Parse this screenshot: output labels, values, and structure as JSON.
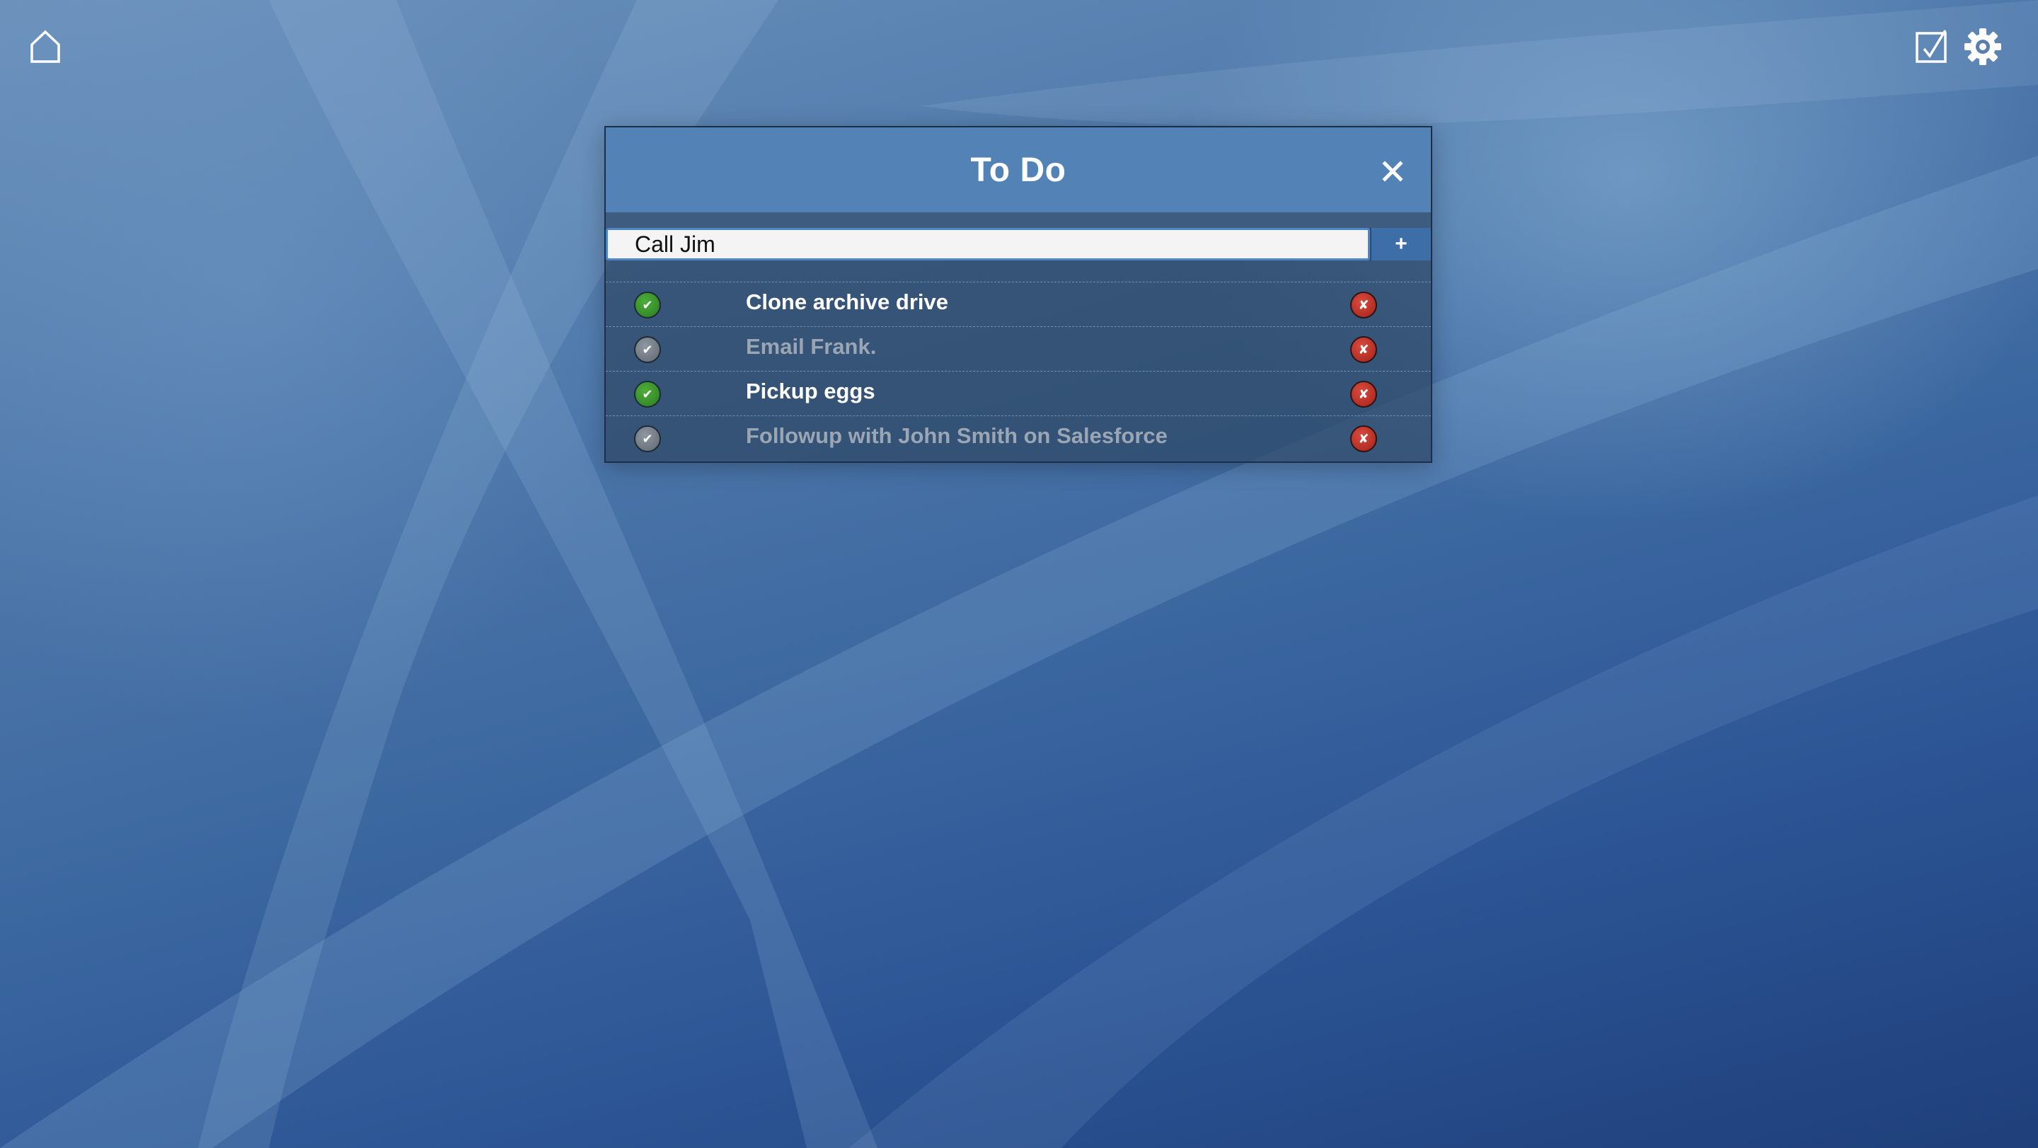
{
  "desktop": {
    "home_icon": "home-icon",
    "tasks_icon": "checkbox-icon",
    "settings_icon": "gear-icon"
  },
  "todo": {
    "title": "To Do",
    "close_icon": "close-icon",
    "input_value": "Call Jim",
    "add_label": "+",
    "check_glyph": "✔",
    "delete_glyph": "✘",
    "items": [
      {
        "text": "Clone archive drive",
        "done": true
      },
      {
        "text": "Email Frank.",
        "done": false
      },
      {
        "text": "Pickup eggs",
        "done": true
      },
      {
        "text": "Followup with John Smith on Salesforce",
        "done": false
      }
    ]
  },
  "colors": {
    "header": "#5383b6",
    "done_check": "#3a9a2c",
    "pending_check": "#7a828b",
    "delete": "#c0392b"
  }
}
